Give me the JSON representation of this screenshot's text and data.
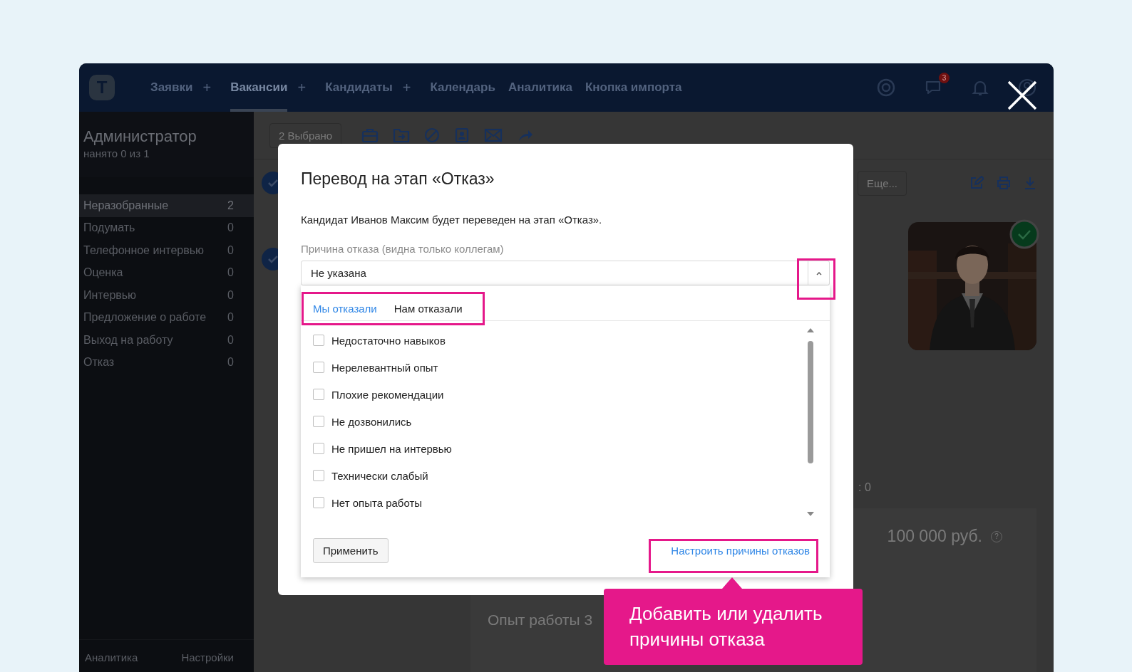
{
  "app": {
    "nav": {
      "logo_letter": "T",
      "items": [
        {
          "label": "Заявки",
          "plus": "+",
          "selected": false
        },
        {
          "label": "Вакансии",
          "plus": "+",
          "selected": true
        },
        {
          "label": "Кандидаты",
          "plus": "+",
          "selected": false
        },
        {
          "label": "Календарь",
          "selected": false
        },
        {
          "label": "Аналитика",
          "selected": false
        },
        {
          "label": "Кнопка импорта",
          "selected": false
        }
      ],
      "chat_badge": "3"
    },
    "sidebar": {
      "title": "Администратор",
      "subtitle": "нанято 0 из 1",
      "stages": [
        {
          "label": "Неразобранные",
          "count": "2",
          "selected": true
        },
        {
          "label": "Подумать",
          "count": "0",
          "selected": false
        },
        {
          "label": "Телефонное интервью",
          "count": "0",
          "selected": false
        },
        {
          "label": "Оценка",
          "count": "0",
          "selected": false
        },
        {
          "label": "Интервью",
          "count": "0",
          "selected": false
        },
        {
          "label": "Предложение о работе",
          "count": "0",
          "selected": false
        },
        {
          "label": "Выход на работу",
          "count": "0",
          "selected": false
        },
        {
          "label": "Отказ",
          "count": "0",
          "selected": false
        }
      ],
      "footer": [
        "Аналитика",
        "Настройки"
      ]
    },
    "toolbar": {
      "selection_button": "2 Выбрано",
      "more_button": "Еще..."
    },
    "candidate": {
      "verified": true,
      "counter_fragment": ": 0",
      "salary": "100 000 руб.",
      "help_mark": "?",
      "experience_heading": "Опыт работы 3"
    }
  },
  "dialog": {
    "title": "Перевод на этап «Отказ»",
    "message": "Кандидат Иванов Максим будет переведен на этап «Отказ».",
    "reason_label": "Причина отказа (видна только коллегам)",
    "reason_value": "Не указана",
    "expanded": true,
    "tabs": [
      {
        "label": "Мы отказали",
        "selected": true
      },
      {
        "label": "Нам отказали",
        "selected": false
      }
    ],
    "reasons": [
      {
        "label": "Недостаточно навыков",
        "checked": false
      },
      {
        "label": "Нерелевантный опыт",
        "checked": false
      },
      {
        "label": "Плохие рекомендации",
        "checked": false
      },
      {
        "label": "Не дозвонились",
        "checked": false
      },
      {
        "label": "Не пришел на интервью",
        "checked": false
      },
      {
        "label": "Технически слабый",
        "checked": false
      },
      {
        "label": "Нет опыта работы",
        "checked": false
      }
    ],
    "apply_button": "Применить",
    "settings_link": "Настроить причины отказов"
  },
  "hint": {
    "text": "Добавить или удалить причины отказа"
  }
}
